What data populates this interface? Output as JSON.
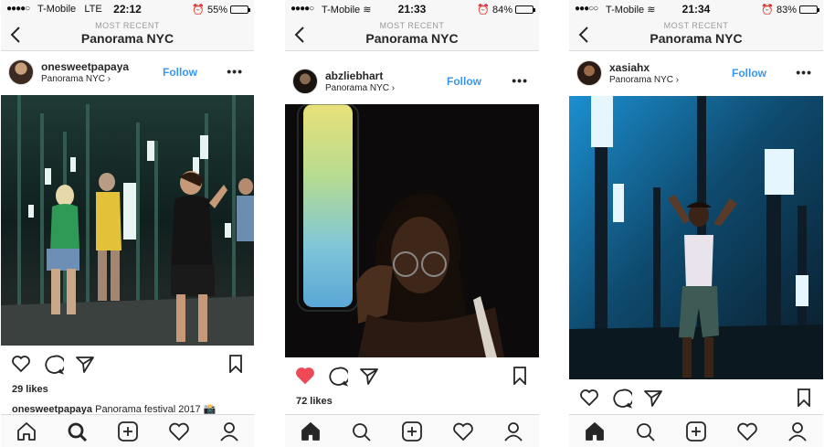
{
  "screens": [
    {
      "status": {
        "carrier": "T-Mobile",
        "network": "LTE",
        "time": "22:12",
        "battery": "55%",
        "battery_level": 0.55
      },
      "nav": {
        "subtitle": "MOST RECENT",
        "title": "Panorama NYC"
      },
      "post": {
        "username": "onesweetpapaya",
        "location": "Panorama NYC ›",
        "follow_label": "Follow",
        "more_label": "•••",
        "liked": false,
        "likes": "29 likes",
        "caption_user": "onesweetpapaya",
        "caption_text": " Panorama festival 2017 📸"
      },
      "tabbar_active": "search"
    },
    {
      "status": {
        "carrier": "T-Mobile",
        "network": "",
        "time": "21:33",
        "battery": "84%",
        "battery_level": 0.84
      },
      "nav": {
        "subtitle": "MOST RECENT",
        "title": "Panorama NYC"
      },
      "post": {
        "username": "abzliebhart",
        "location": "Panorama NYC ›",
        "follow_label": "Follow",
        "more_label": "•••",
        "liked": true,
        "likes": "72 likes"
      },
      "tabbar_active": "home"
    },
    {
      "status": {
        "carrier": "T-Mobile",
        "network": "",
        "time": "21:34",
        "battery": "83%",
        "battery_level": 0.83
      },
      "nav": {
        "subtitle": "MOST RECENT",
        "title": "Panorama NYC"
      },
      "post": {
        "username": "xasiahx",
        "location": "Panorama NYC ›",
        "follow_label": "Follow",
        "more_label": "•••",
        "liked": false
      },
      "tabbar_active": "home"
    }
  ],
  "colors": {
    "follow": "#3897f0",
    "liked_heart": "#ed4956",
    "icon": "#262626"
  },
  "icons": [
    "back-icon",
    "heart-icon",
    "comment-icon",
    "share-icon",
    "bookmark-icon",
    "home-icon",
    "search-icon",
    "add-icon",
    "activity-icon",
    "profile-icon"
  ]
}
